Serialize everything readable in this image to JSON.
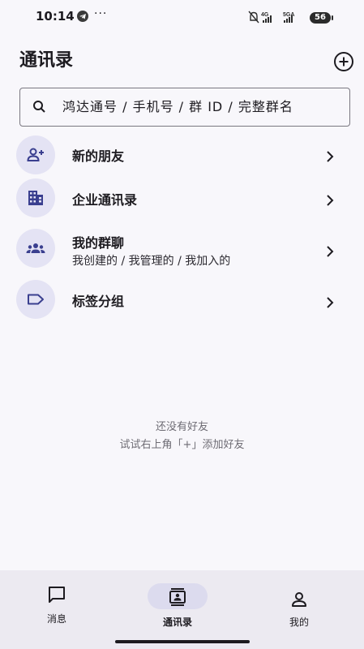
{
  "status_bar": {
    "time": "10:14",
    "dots": "···",
    "network_1": "4G",
    "network_2": "5GA",
    "battery": "56"
  },
  "header": {
    "title": "通讯录",
    "add_icon": "plus-circle-icon"
  },
  "search": {
    "placeholder": "鸿达通号 / 手机号 / 群 ID / 完整群名"
  },
  "list": [
    {
      "label": "新的朋友",
      "icon": "person-add-icon"
    },
    {
      "label": "企业通讯录",
      "icon": "building-icon"
    },
    {
      "label": "我的群聊",
      "sub": "我创建的 / 我管理的 / 我加入的",
      "icon": "group-icon"
    },
    {
      "label": "标签分组",
      "icon": "tag-icon"
    }
  ],
  "empty_state": {
    "line1": "还没有好友",
    "line2": "试试右上角「+」添加好友"
  },
  "bottom_nav": [
    {
      "label": "消息",
      "icon": "chat-bubble-icon"
    },
    {
      "label": "通讯录",
      "icon": "contacts-icon",
      "active": true
    },
    {
      "label": "我的",
      "icon": "person-icon"
    }
  ],
  "colors": {
    "background": "#f8f7fb",
    "avatar_bg": "#e4e3f4",
    "nav_bg": "#eceaf1",
    "active_pill": "#dcdbee",
    "icon": "#3a3f8f"
  }
}
